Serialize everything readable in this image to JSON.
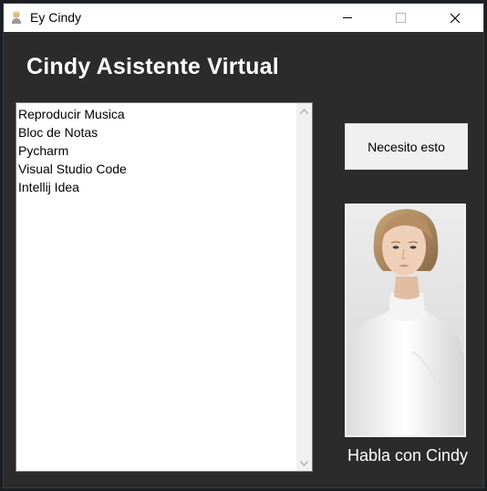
{
  "window": {
    "title": "Ey Cindy",
    "icons": {
      "app": "user-icon",
      "minimize": "minimize-icon",
      "maximize": "maximize-icon",
      "close": "close-icon"
    }
  },
  "main": {
    "heading": "Cindy Asistente Virtual",
    "list": {
      "items": [
        "Reproducir Musica",
        "Bloc de Notas",
        "Pycharm",
        "Visual Studio Code",
        "Intellij Idea"
      ]
    },
    "button_label": "Necesito esto",
    "portrait_caption": "Habla con Cindy"
  },
  "colors": {
    "window_bg": "#2b2b2b",
    "text_light": "#ffffff",
    "button_bg": "#f0f0f0"
  }
}
